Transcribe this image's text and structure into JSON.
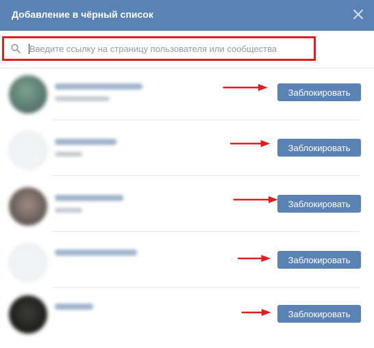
{
  "dialog": {
    "title": "Добавление в чёрный список",
    "close_icon": "close-icon"
  },
  "search": {
    "placeholder": "Введите ссылку на страницу пользователя или сообщества",
    "value": "",
    "icon": "search-icon"
  },
  "annotation_color": "#e41c1c",
  "accent_color": "#5b82b5",
  "users": [
    {
      "block_label": "Заблокировать",
      "avatar": "blurred-photo"
    },
    {
      "block_label": "Заблокировать",
      "avatar": "blurred-default"
    },
    {
      "block_label": "Заблокировать",
      "avatar": "blurred-photo"
    },
    {
      "block_label": "Заблокировать",
      "avatar": "blurred-default"
    },
    {
      "block_label": "Заблокировать",
      "avatar": "blurred-photo"
    }
  ]
}
